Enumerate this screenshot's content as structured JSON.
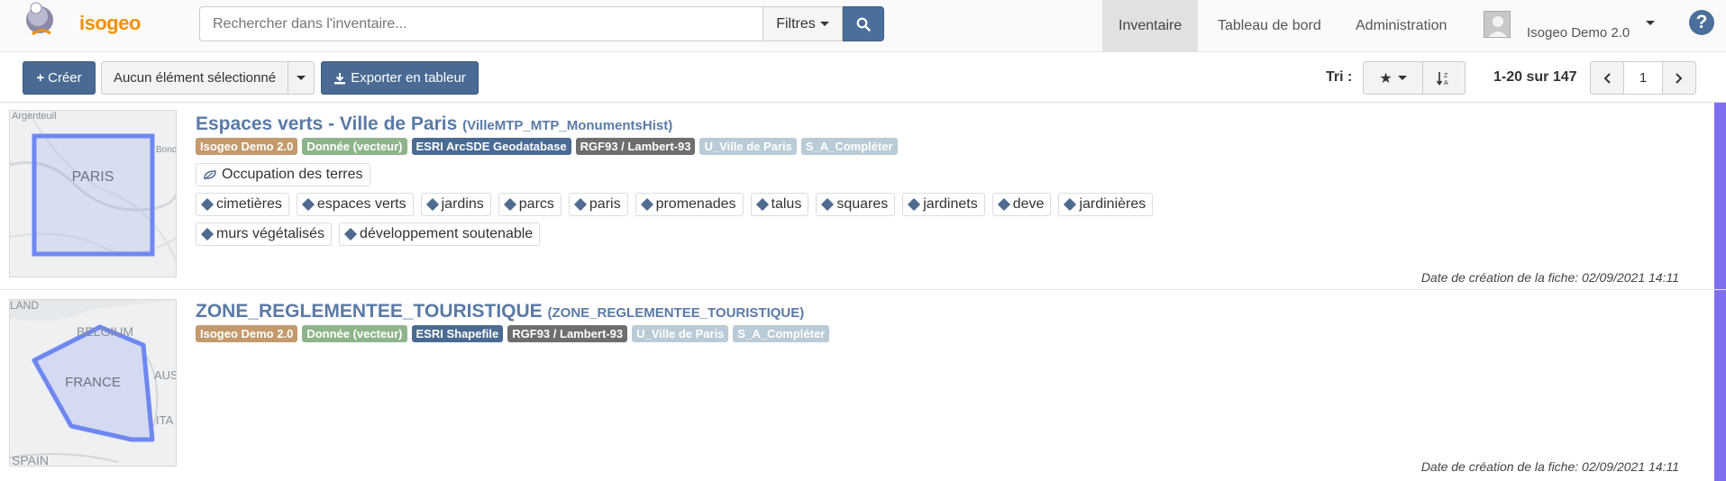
{
  "app": {
    "logo_text": "isogeo"
  },
  "search": {
    "placeholder": "Rechercher dans l'inventaire...",
    "filters_label": "Filtres"
  },
  "nav": {
    "tabs": [
      {
        "label": "Inventaire",
        "active": true
      },
      {
        "label": "Tableau de bord",
        "active": false
      },
      {
        "label": "Administration",
        "active": false
      }
    ],
    "user_name": "Isogeo Demo 2.0"
  },
  "toolbar": {
    "create_label": "Créer",
    "selection_label": "Aucun élément sélectionné",
    "export_label": "Exporter en tableur",
    "sort_label": "Tri :",
    "pagination_text": "1-20 sur 147",
    "page_value": "1"
  },
  "results": [
    {
      "title": "Espaces verts - Ville de Paris",
      "subtitle": "(VilleMTP_MTP_MonumentsHist)",
      "map_label": "PARIS",
      "map_corner_labels": [
        "Argenteuil",
        "Bondy"
      ],
      "badges": [
        {
          "label": "Isogeo Demo 2.0",
          "color": "#c49a6c"
        },
        {
          "label": "Donnée (vecteur)",
          "color": "#8fb48b"
        },
        {
          "label": "ESRI ArcSDE Geodatabase",
          "color": "#4a6a93"
        },
        {
          "label": "RGF93 / Lambert-93",
          "color": "#6e6e6e"
        },
        {
          "label": "U_Ville de Paris",
          "color": "#b9cbd6"
        },
        {
          "label": "S_A_Compléter",
          "color": "#b9cbd6"
        }
      ],
      "theme": "Occupation des terres",
      "keywords": [
        "cimetières",
        "espaces verts",
        "jardins",
        "parcs",
        "paris",
        "promenades",
        "talus",
        "squares",
        "jardinets",
        "deve",
        "jardinières"
      ],
      "keywords2": [
        "murs végétalisés",
        "développement soutenable"
      ],
      "date": "Date de création de la fiche: 02/09/2021 14:11"
    },
    {
      "title": "ZONE_REGLEMENTEE_TOURISTIQUE",
      "subtitle": "(ZONE_REGLEMENTEE_TOURISTIQUE)",
      "map_labels": [
        "LAND",
        "BELGIUM",
        "FRANCE",
        "AUS",
        "ITA",
        "SPAIN"
      ],
      "badges": [
        {
          "label": "Isogeo Demo 2.0",
          "color": "#c49a6c"
        },
        {
          "label": "Donnée (vecteur)",
          "color": "#8fb48b"
        },
        {
          "label": "ESRI Shapefile",
          "color": "#4a6a93"
        },
        {
          "label": "RGF93 / Lambert-93",
          "color": "#6e6e6e"
        },
        {
          "label": "U_Ville de Paris",
          "color": "#b9cbd6"
        },
        {
          "label": "S_A_Compléter",
          "color": "#b9cbd6"
        }
      ],
      "date": "Date de création de la fiche: 02/09/2021 14:11"
    }
  ],
  "colors": {
    "accent": "#4a6a93",
    "sidebar_marker": "#7f6ff0",
    "logo": "#f29000"
  }
}
